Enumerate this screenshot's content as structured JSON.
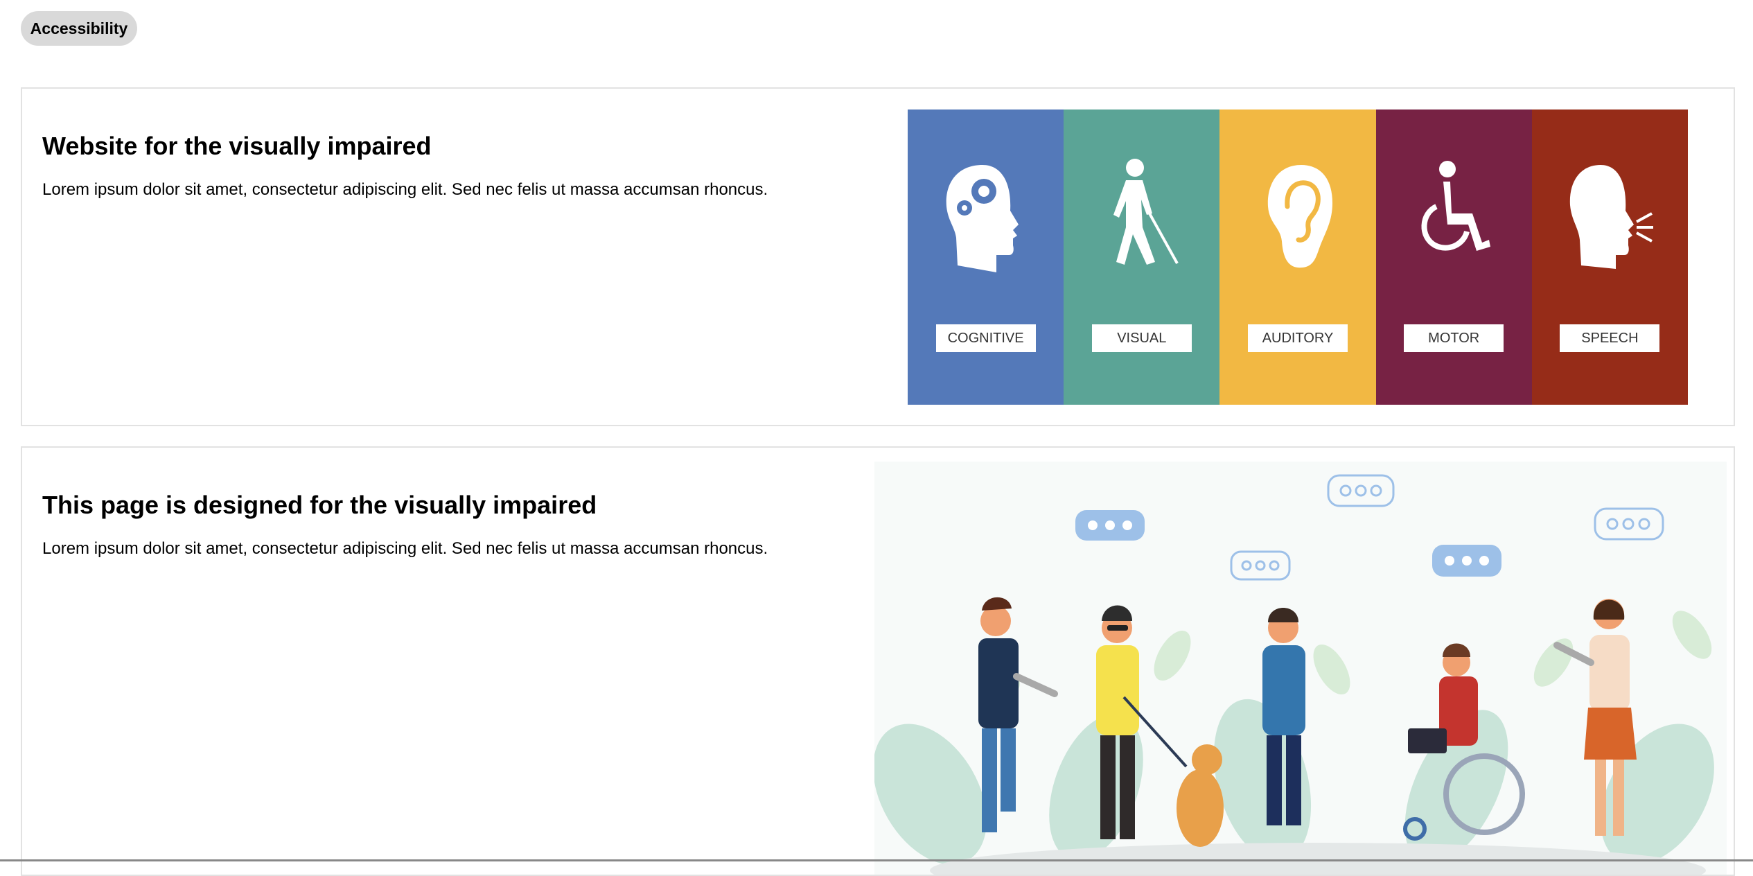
{
  "header": {
    "accessibility_button": "Accessibility"
  },
  "section1": {
    "title": "Website for the visually impaired",
    "body": "Lorem ipsum dolor sit amet, consectetur adipiscing elit. Sed nec felis ut massa accumsan rhoncus.",
    "categories": [
      {
        "label": "COGNITIVE",
        "color": "#5479b9",
        "icon": "head-gears-icon"
      },
      {
        "label": "VISUAL",
        "color": "#5ba496",
        "icon": "person-with-cane-icon"
      },
      {
        "label": "AUDITORY",
        "color": "#f2b843",
        "icon": "ear-icon"
      },
      {
        "label": "MOTOR",
        "color": "#772244",
        "icon": "wheelchair-icon"
      },
      {
        "label": "SPEECH",
        "color": "#962c18",
        "icon": "speaking-head-icon"
      }
    ]
  },
  "section2": {
    "title": "This page is designed for the visually impaired",
    "body": "Lorem ipsum dolor sit amet, consectetur adipiscing elit. Sed nec felis ut massa accumsan rhoncus."
  }
}
